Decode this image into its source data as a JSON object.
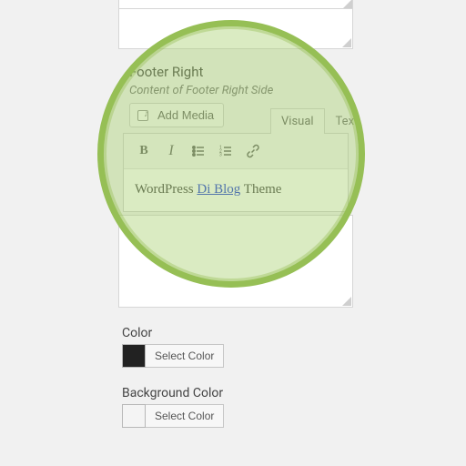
{
  "section": {
    "title": "Footer Right",
    "desc": "Content of Footer Right Side"
  },
  "buttons": {
    "add_media": "Add Media",
    "select_color": "Select Color"
  },
  "tabs": {
    "visual": "Visual",
    "text": "Text"
  },
  "editor": {
    "pre": "WordPress ",
    "link": "Di Blog",
    "post": " Theme"
  },
  "labels": {
    "color": "Color",
    "bg_color": "Background Color"
  },
  "colors": {
    "text_swatch": "#222222",
    "bg_swatch": "#f4f4f4"
  }
}
